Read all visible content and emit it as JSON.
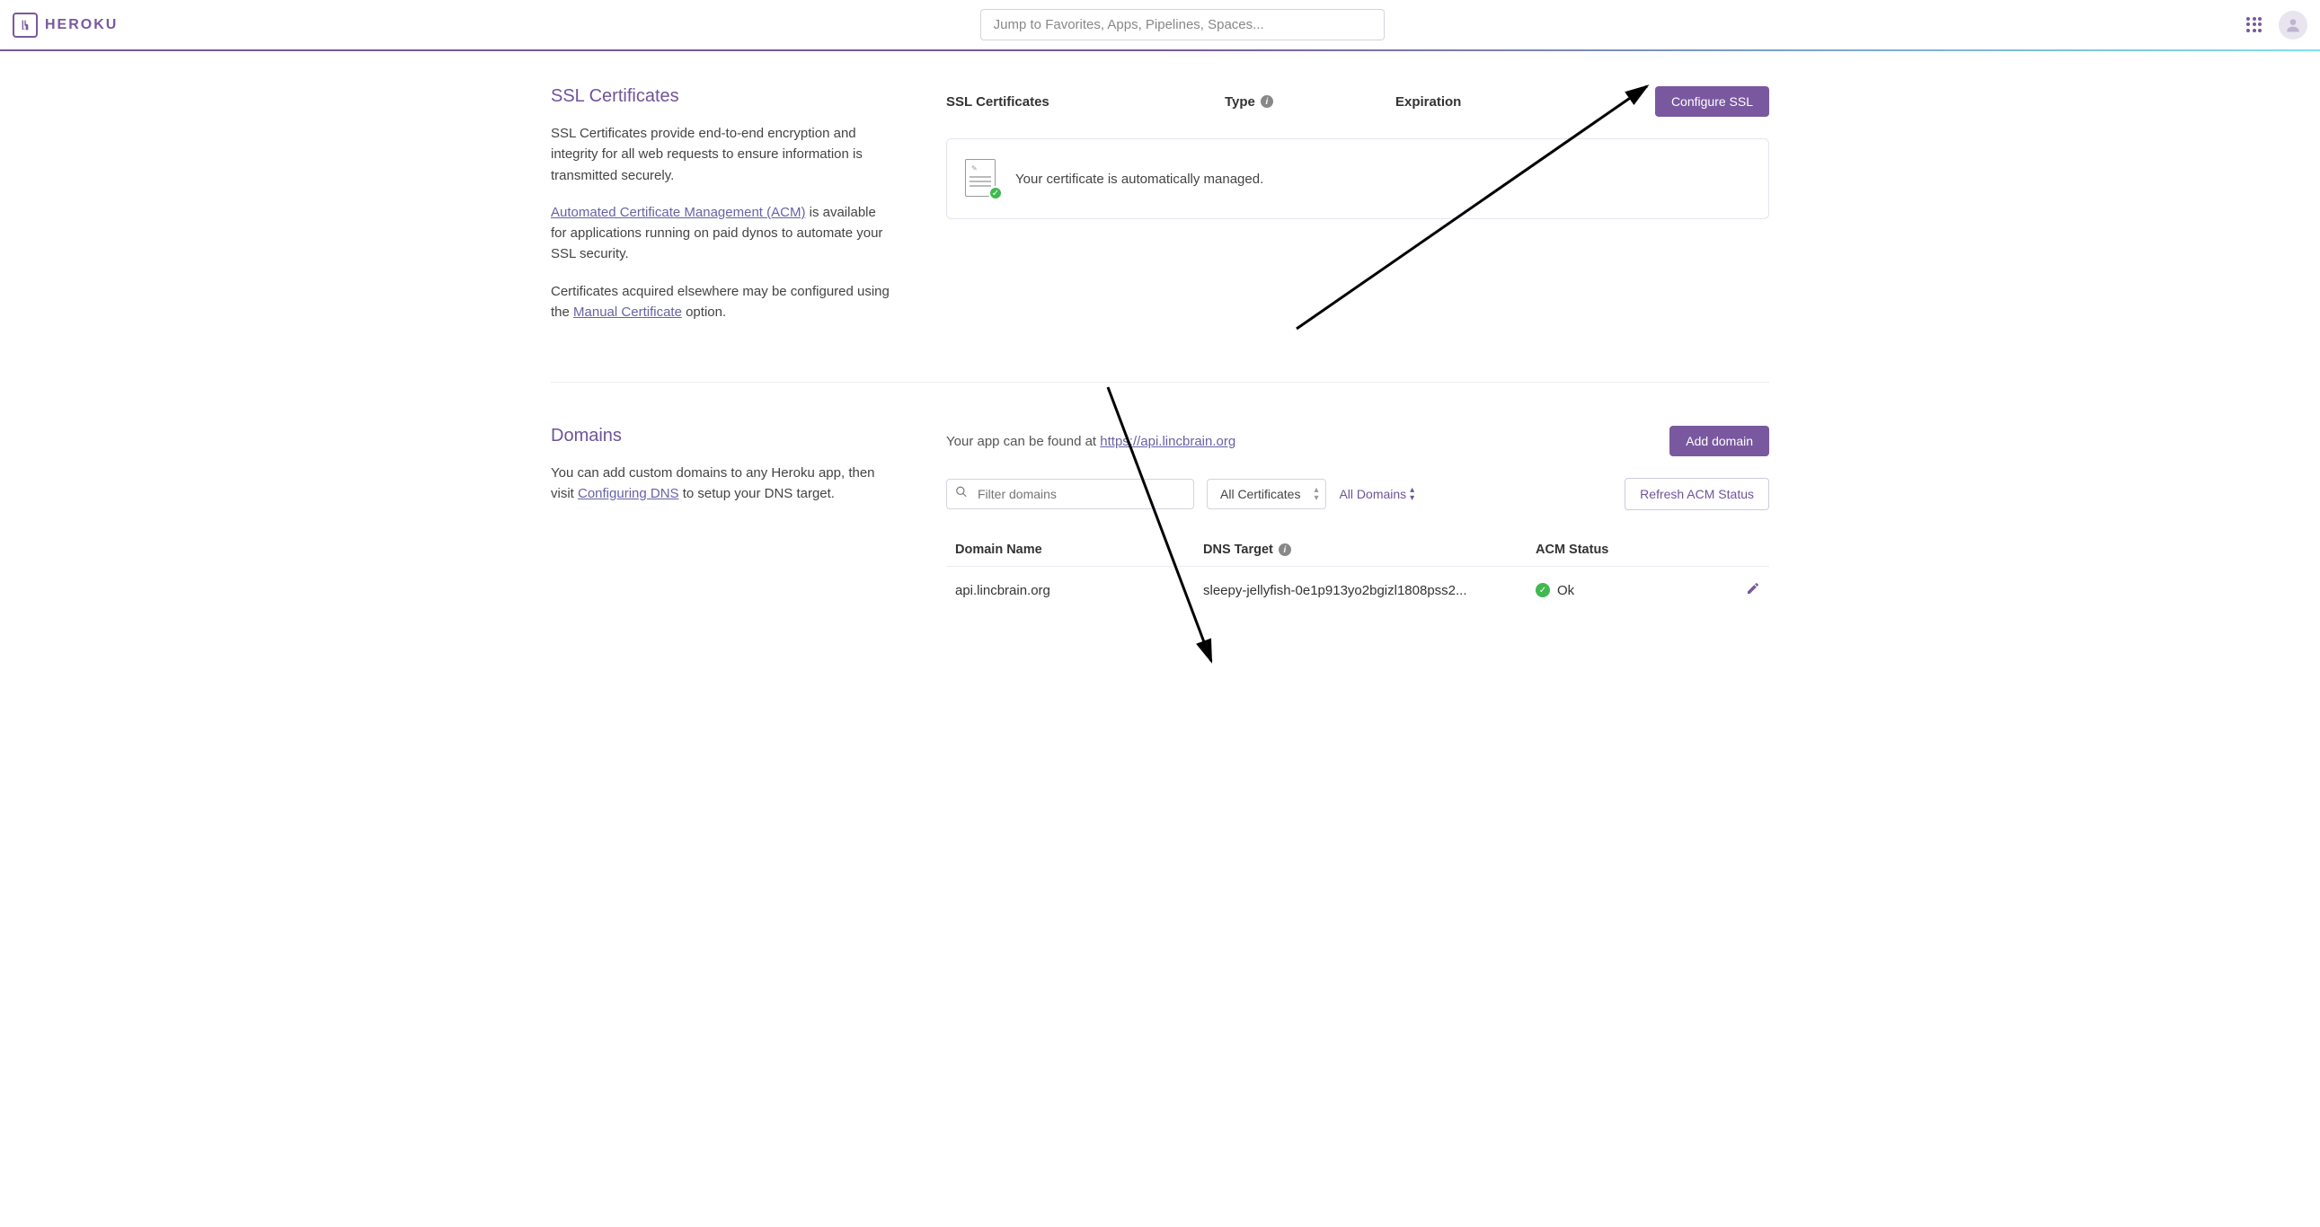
{
  "header": {
    "brand": "HEROKU",
    "search_placeholder": "Jump to Favorites, Apps, Pipelines, Spaces..."
  },
  "ssl": {
    "section_title": "SSL Certificates",
    "desc_1": "SSL Certificates provide end-to-end encryption and integrity for all web requests to ensure information is transmitted securely.",
    "acm_link": "Automated Certificate Management (ACM)",
    "acm_rest": " is available for applications running on paid dynos to automate your SSL security.",
    "manual_pre": "Certificates acquired elsewhere may be configured using the ",
    "manual_link": "Manual Certificate",
    "manual_post": " option.",
    "header_cert": "SSL Certificates",
    "header_type": "Type",
    "header_exp": "Expiration",
    "configure_btn": "Configure SSL",
    "auto_msg": "Your certificate is automatically managed."
  },
  "domains": {
    "section_title": "Domains",
    "desc_pre": "You can add custom domains to any Heroku app, then visit ",
    "desc_link": "Configuring DNS",
    "desc_post": " to setup your DNS target.",
    "found_pre": "Your app can be found at ",
    "found_url": "https://api.lincbrain.org",
    "add_btn": "Add domain",
    "filter_placeholder": "Filter domains",
    "cert_select": "All Certificates",
    "all_domains": "All Domains",
    "refresh_btn": "Refresh ACM Status",
    "th_name": "Domain Name",
    "th_dns": "DNS Target",
    "th_acm": "ACM Status",
    "row": {
      "name": "api.lincbrain.org",
      "dns": "sleepy-jellyfish-0e1p913yo2bgizl1808pss2...",
      "acm": "Ok"
    }
  }
}
